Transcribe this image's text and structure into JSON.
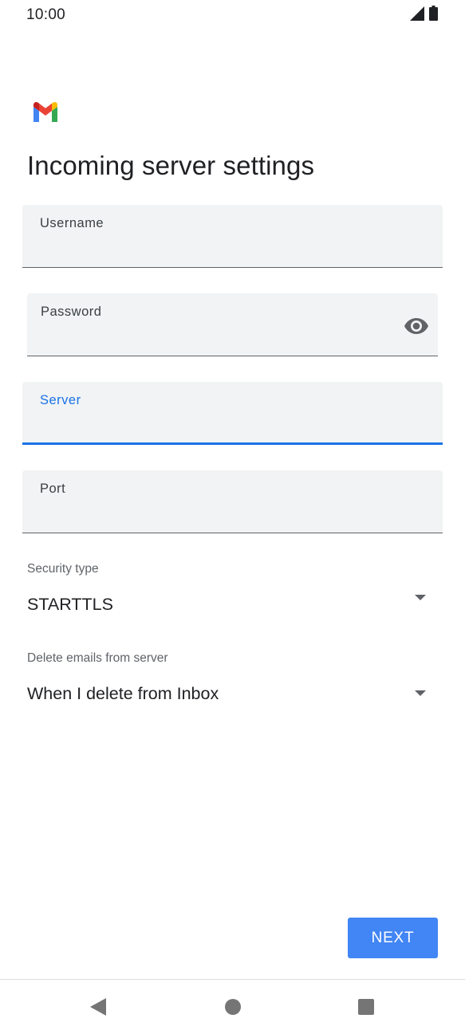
{
  "status_bar": {
    "time": "10:00",
    "icons": [
      "signal-icon",
      "battery-icon"
    ]
  },
  "app": {
    "logo": "gmail-logo",
    "title": "Incoming server settings"
  },
  "form": {
    "username": {
      "label": "Username",
      "value": ""
    },
    "password": {
      "label": "Password",
      "value": "",
      "toggle_icon": "eye-icon"
    },
    "server": {
      "label": "Server",
      "value": "",
      "focused": true
    },
    "port": {
      "label": "Port",
      "value": ""
    },
    "security_type": {
      "label": "Security type",
      "value": "STARTTLS"
    },
    "delete_emails": {
      "label": "Delete emails from server",
      "value": "When I delete from Inbox"
    }
  },
  "actions": {
    "next_label": "NEXT"
  },
  "nav_bar": {
    "icons": [
      "back-icon",
      "home-icon",
      "recents-icon"
    ]
  },
  "colors": {
    "accent": "#1a73e8",
    "button": "#4285f4",
    "field_bg": "#f1f3f4",
    "text": "#202124"
  }
}
